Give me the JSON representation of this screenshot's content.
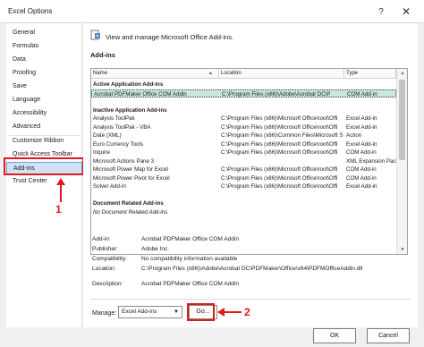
{
  "window": {
    "title": "Excel Options",
    "help_glyph": "?",
    "close_glyph": "✕"
  },
  "sidebar": {
    "items": [
      {
        "label": "General"
      },
      {
        "label": "Formulas"
      },
      {
        "label": "Data"
      },
      {
        "label": "Proofing"
      },
      {
        "label": "Save"
      },
      {
        "label": "Language"
      },
      {
        "label": "Accessibility"
      },
      {
        "label": "Advanced"
      },
      {
        "label": "Customize Ribbon"
      },
      {
        "label": "Quick Access Toolbar"
      },
      {
        "label": "Add-ins"
      },
      {
        "label": "Trust Center"
      }
    ],
    "active_index": 10
  },
  "annotations": {
    "one": "1",
    "two": "2",
    "color": "#e01a1a"
  },
  "main": {
    "header_text": "View and manage Microsoft Office Add-ins.",
    "section_title": "Add-ins",
    "columns": {
      "name": "Name",
      "sort_glyph": "▲",
      "location": "Location",
      "type": "Type"
    },
    "rows": [
      {
        "name": "Active Application Add-ins",
        "location": "",
        "type": "",
        "kind": "group"
      },
      {
        "name": "Acrobat PDFMaker Office COM Addin",
        "location": "C:\\Program Files (x86)\\Adobe\\Acrobat DC\\P",
        "type": "COM Add-in",
        "kind": "selected"
      },
      {
        "name": "",
        "location": "",
        "type": "",
        "kind": "blank"
      },
      {
        "name": "Inactive Application Add-ins",
        "location": "",
        "type": "",
        "kind": "group"
      },
      {
        "name": "Analysis ToolPak",
        "location": "C:\\Program Files (x86)\\Microsoft Office\\root\\Offi",
        "type": "Excel Add-in",
        "kind": "item"
      },
      {
        "name": "Analysis ToolPak - VBA",
        "location": "C:\\Program Files (x86)\\Microsoft Office\\root\\Offi",
        "type": "Excel Add-in",
        "kind": "item"
      },
      {
        "name": "Date (XML)",
        "location": "C:\\Program Files (x86)\\Common Files\\Microsoft S",
        "type": "Action",
        "kind": "item"
      },
      {
        "name": "Euro Currency Tools",
        "location": "C:\\Program Files (x86)\\Microsoft Office\\root\\Offi",
        "type": "Excel Add-in",
        "kind": "item"
      },
      {
        "name": "Inquire",
        "location": "C:\\Program Files (x86)\\Microsoft Office\\root\\Offi",
        "type": "COM Add-in",
        "kind": "item"
      },
      {
        "name": "Microsoft Actions Pane 3",
        "location": "",
        "type": "XML Expansion Pack",
        "kind": "item"
      },
      {
        "name": "Microsoft Power Map for Excel",
        "location": "C:\\Program Files (x86)\\Microsoft Office\\root\\Offi",
        "type": "COM Add-in",
        "kind": "item"
      },
      {
        "name": "Microsoft Power Pivot for Excel",
        "location": "C:\\Program Files (x86)\\Microsoft Office\\root\\Offi",
        "type": "COM Add-in",
        "kind": "item"
      },
      {
        "name": "Solver Add-in",
        "location": "C:\\Program Files (x86)\\Microsoft Office\\root\\Offi",
        "type": "Excel Add-in",
        "kind": "item"
      },
      {
        "name": "",
        "location": "",
        "type": "",
        "kind": "blank"
      },
      {
        "name": "Document Related Add-ins",
        "location": "",
        "type": "",
        "kind": "group"
      },
      {
        "name": "No Document Related Add-ins",
        "location": "",
        "type": "",
        "kind": "italic"
      }
    ],
    "details": {
      "addin_label": "Add-in:",
      "addin_value": "Acrobat PDFMaker Office COM Addin",
      "publisher_label": "Publisher:",
      "publisher_value": "Adobe Inc.",
      "compat_label": "Compatibility:",
      "compat_value": "No compatibility information available",
      "location_label": "Location:",
      "location_value": "C:\\Program Files (x86)\\Adobe\\Acrobat DC\\PDFMaker\\Office\\x64\\PDFMOfficeAddin.dll",
      "description_label": "Description:",
      "description_value": "Acrobat PDFMaker Office COM Addin"
    },
    "manage_label": "Manage:",
    "manage_value": "Excel Add-ins",
    "go_label": "Go..."
  },
  "footer": {
    "ok_label": "OK",
    "cancel_label": "Cancel"
  }
}
